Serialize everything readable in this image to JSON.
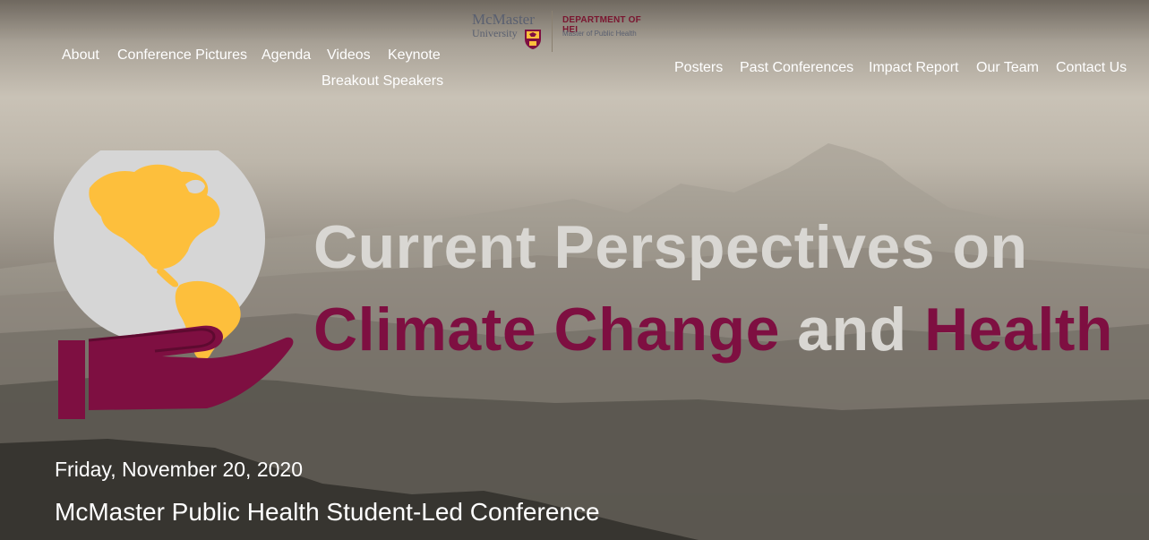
{
  "nav_left": {
    "about": "About",
    "conference_pictures": "Conference Pictures",
    "agenda": "Agenda",
    "videos": "Videos",
    "keynote": "Keynote",
    "breakout_speakers": "Breakout Speakers"
  },
  "nav_right": {
    "posters": "Posters",
    "past_conferences": "Past Conferences",
    "impact_report": "Impact Report",
    "our_team": "Our Team",
    "contact_us": "Contact Us"
  },
  "logo": {
    "university_line1": "McMaster",
    "university_line2": "University",
    "department": "DEPARTMENT OF HEI",
    "program": "Master of Public Health"
  },
  "hero": {
    "title_line1": "Current Perspectives on",
    "title_part1": "Climate Change",
    "title_part2": " and ",
    "title_part3": "Health",
    "date": "Friday, November 20, 2020",
    "subtitle": "McMaster Public Health Student-Led Conference"
  },
  "colors": {
    "maroon": "#7e0f41",
    "gold": "#fdbf3c",
    "globe_gray": "#d6d6d6",
    "title_gray": "#d9d7d3"
  },
  "icons": {
    "hero_graphic": "globe-in-hand-icon",
    "crest": "university-crest-icon"
  }
}
